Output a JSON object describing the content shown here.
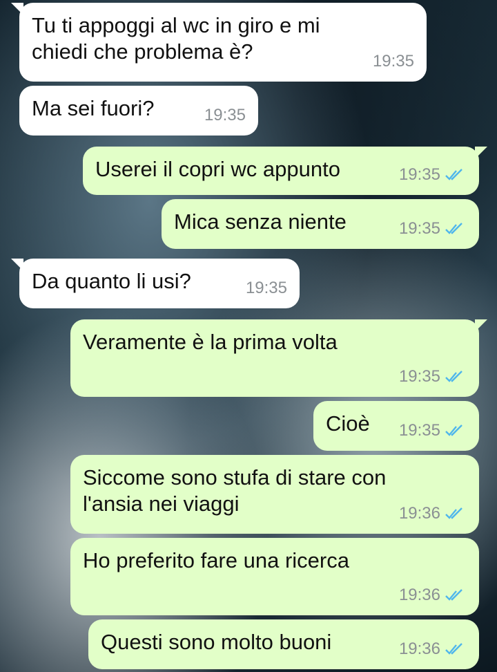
{
  "messages": [
    {
      "text": "Tu ti appoggi al wc in giro e mi\nchiedi che problema è?",
      "time": "19:35",
      "direction": "incoming"
    },
    {
      "text": "Ma sei fuori?",
      "time": "19:35",
      "direction": "incoming"
    },
    {
      "text": "Userei il copri wc appunto",
      "time": "19:35",
      "direction": "outgoing",
      "status": "read"
    },
    {
      "text": "Mica senza niente",
      "time": "19:35",
      "direction": "outgoing",
      "status": "read"
    },
    {
      "text": "Da quanto li usi?",
      "time": "19:35",
      "direction": "incoming"
    },
    {
      "text": "Veramente è la prima volta",
      "time": "19:35",
      "direction": "outgoing",
      "status": "read"
    },
    {
      "text": "Cioè",
      "time": "19:35",
      "direction": "outgoing",
      "status": "read"
    },
    {
      "text": "Siccome sono stufa di stare con\nl'ansia nei viaggi",
      "time": "19:36",
      "direction": "outgoing",
      "status": "read"
    },
    {
      "text": "Ho preferito fare una ricerca",
      "time": "19:36",
      "direction": "outgoing",
      "status": "read"
    },
    {
      "text": "Questi sono molto buoni",
      "time": "19:36",
      "direction": "outgoing",
      "status": "read"
    }
  ],
  "colors": {
    "incoming_bubble": "#ffffff",
    "outgoing_bubble": "#e2ffc8",
    "read_ticks": "#4fb6ec",
    "timestamp": "#8a8f93"
  },
  "icons": {
    "read_receipt": "double-check-icon"
  }
}
